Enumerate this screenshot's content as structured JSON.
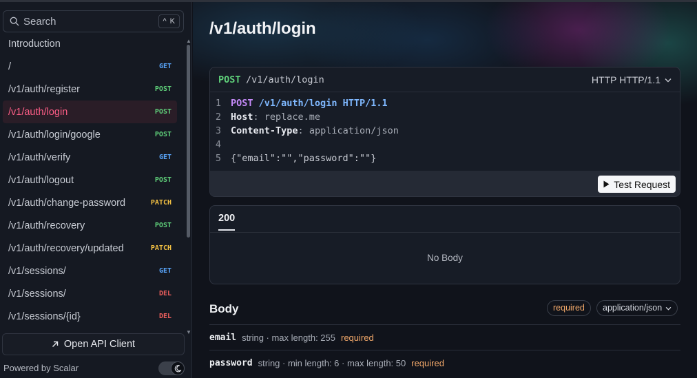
{
  "sidebar": {
    "search_placeholder": "Search",
    "search_shortcut": "^ K",
    "items": [
      {
        "label": "Introduction",
        "method": ""
      },
      {
        "label": "/",
        "method": "GET"
      },
      {
        "label": "/v1/auth/register",
        "method": "POST"
      },
      {
        "label": "/v1/auth/login",
        "method": "POST",
        "active": true
      },
      {
        "label": "/v1/auth/login/google",
        "method": "POST"
      },
      {
        "label": "/v1/auth/verify",
        "method": "GET"
      },
      {
        "label": "/v1/auth/logout",
        "method": "POST"
      },
      {
        "label": "/v1/auth/change-password",
        "method": "PATCH"
      },
      {
        "label": "/v1/auth/recovery",
        "method": "POST"
      },
      {
        "label": "/v1/auth/recovery/updated",
        "method": "PATCH"
      },
      {
        "label": "/v1/sessions/",
        "method": "GET"
      },
      {
        "label": "/v1/sessions/",
        "method": "DEL"
      },
      {
        "label": "/v1/sessions/{id}",
        "method": "DEL"
      }
    ],
    "open_client_label": "Open API Client",
    "powered_by": "Powered by Scalar"
  },
  "main": {
    "title": "/v1/auth/login",
    "request": {
      "method": "POST",
      "path": "/v1/auth/login",
      "protocol_selector": "HTTP HTTP/1.1",
      "lines": {
        "l1_method": "POST",
        "l1_path": "/v1/auth/login",
        "l1_proto": "HTTP/1.1",
        "l2_key": "Host",
        "l2_val": "replace.me",
        "l3_key": "Content-Type",
        "l3_val": "application/json",
        "l5_body": "{\"email\":\"\",\"password\":\"\"}"
      },
      "test_button": "Test Request"
    },
    "response": {
      "tab": "200",
      "empty": "No Body"
    },
    "body": {
      "title": "Body",
      "required_badge": "required",
      "content_type": "application/json",
      "fields": [
        {
          "name": "email",
          "meta": "string · max length:  255",
          "required": "required"
        },
        {
          "name": "password",
          "meta": "string · min length:  6 · max length:  50",
          "required": "required"
        }
      ]
    }
  },
  "colors": {
    "accent_active": "#ff5e87",
    "get": "#5aa8ff",
    "post": "#5fd07a",
    "patch": "#f5c243",
    "delete": "#f0605e",
    "required": "#f3a96a"
  }
}
